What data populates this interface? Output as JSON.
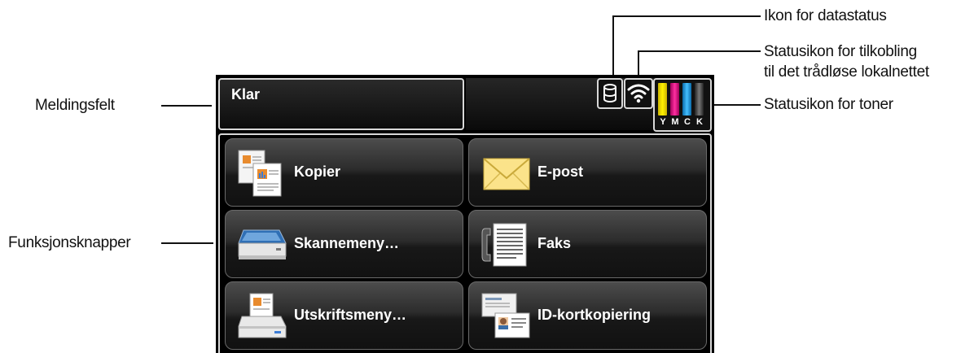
{
  "callouts": {
    "data_status": "Ikon for datastatus",
    "wifi_line1": "Statusikon for tilkobling",
    "wifi_line2": "til det trådløse lokalnettet",
    "toner": "Statusikon for toner",
    "message_field": "Meldingsfelt",
    "function_buttons": "Funksjonsknapper"
  },
  "message": "Klar",
  "toner": {
    "letters": [
      "Y",
      "M",
      "C",
      "K"
    ],
    "colors": [
      "#ffe600",
      "#e6007e",
      "#1ea0e6",
      "#333333"
    ]
  },
  "buttons": {
    "copy": "Kopier",
    "email": "E-post",
    "scan": "Skannemeny…",
    "fax": "Faks",
    "print": "Utskriftsmeny…",
    "id_copy": "ID-kortkopiering"
  },
  "icons": {
    "data": "database-icon",
    "wifi": "wifi-icon",
    "copy": "copy-icon",
    "email": "envelope-icon",
    "scan": "scanner-icon",
    "fax": "fax-icon",
    "print": "printer-icon",
    "id_copy": "id-card-icon"
  }
}
